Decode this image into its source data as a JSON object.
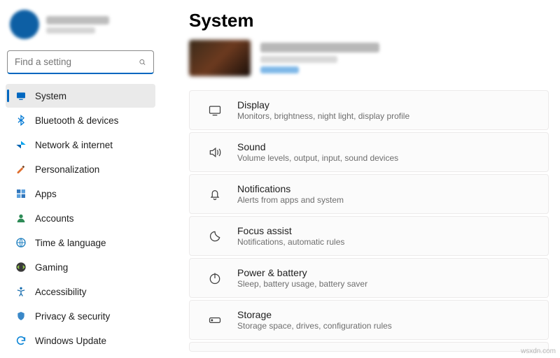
{
  "search": {
    "placeholder": "Find a setting"
  },
  "nav": {
    "items": [
      {
        "label": "System"
      },
      {
        "label": "Bluetooth & devices"
      },
      {
        "label": "Network & internet"
      },
      {
        "label": "Personalization"
      },
      {
        "label": "Apps"
      },
      {
        "label": "Accounts"
      },
      {
        "label": "Time & language"
      },
      {
        "label": "Gaming"
      },
      {
        "label": "Accessibility"
      },
      {
        "label": "Privacy & security"
      },
      {
        "label": "Windows Update"
      }
    ]
  },
  "page": {
    "title": "System"
  },
  "cards": [
    {
      "title": "Display",
      "sub": "Monitors, brightness, night light, display profile"
    },
    {
      "title": "Sound",
      "sub": "Volume levels, output, input, sound devices"
    },
    {
      "title": "Notifications",
      "sub": "Alerts from apps and system"
    },
    {
      "title": "Focus assist",
      "sub": "Notifications, automatic rules"
    },
    {
      "title": "Power & battery",
      "sub": "Sleep, battery usage, battery saver"
    },
    {
      "title": "Storage",
      "sub": "Storage space, drives, configuration rules"
    }
  ],
  "watermark": "wsxdn.com"
}
